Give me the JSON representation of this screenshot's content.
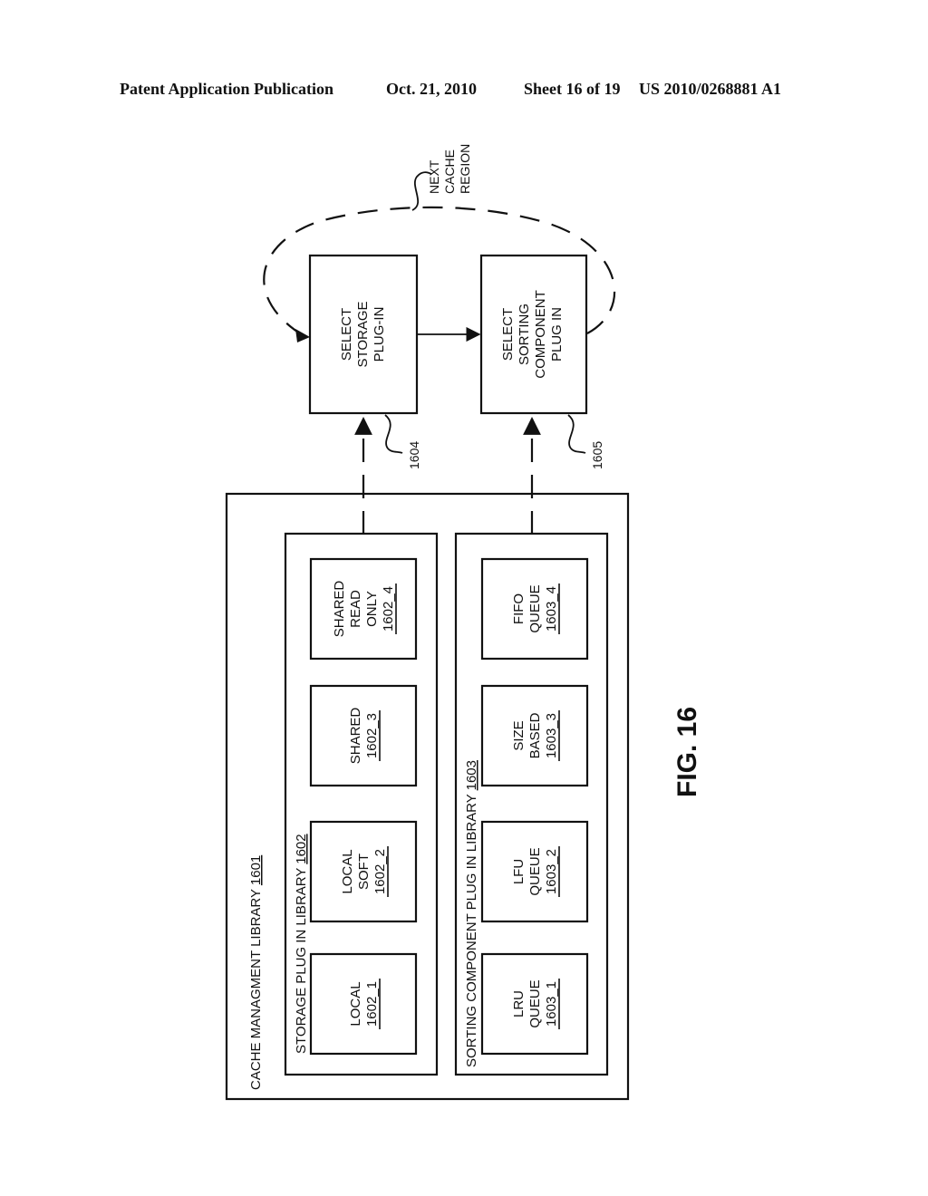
{
  "header": {
    "publication": "Patent Application Publication",
    "date": "Oct. 21, 2010",
    "sheet": "Sheet 16 of 19",
    "number": "US 2010/0268881 A1"
  },
  "figure_label": "FIG. 16",
  "loop_label": [
    "NEXT",
    "CACHE",
    "REGION"
  ],
  "steps": [
    {
      "id": "1604",
      "lines": [
        "SELECT",
        "STORAGE",
        "PLUG-IN"
      ]
    },
    {
      "id": "1605",
      "lines": [
        "SELECT",
        "SORTING",
        "COMPONENT",
        "PLUG IN"
      ]
    }
  ],
  "cache_library": {
    "title": "CACHE MANAGMENT LIBRARY ",
    "ref": "1601"
  },
  "storage_library": {
    "title": "STORAGE PLUG IN LIBRARY ",
    "ref": "1602",
    "items": [
      {
        "lines": [
          "LOCAL"
        ],
        "ref": "1602_1"
      },
      {
        "lines": [
          "LOCAL",
          "SOFT"
        ],
        "ref": "1602_2"
      },
      {
        "lines": [
          "SHARED"
        ],
        "ref": "1602_3"
      },
      {
        "lines": [
          "SHARED",
          "READ",
          "ONLY"
        ],
        "ref": "1602_4"
      }
    ]
  },
  "sorting_library": {
    "title": "SORTING COMPONENT PLUG IN LIBRARY ",
    "ref": "1603",
    "items": [
      {
        "lines": [
          "LRU",
          "QUEUE"
        ],
        "ref": "1603_1"
      },
      {
        "lines": [
          "LFU",
          "QUEUE"
        ],
        "ref": "1603_2"
      },
      {
        "lines": [
          "SIZE",
          "BASED"
        ],
        "ref": "1603_3"
      },
      {
        "lines": [
          "FIFO",
          "QUEUE"
        ],
        "ref": "1603_4"
      }
    ]
  }
}
